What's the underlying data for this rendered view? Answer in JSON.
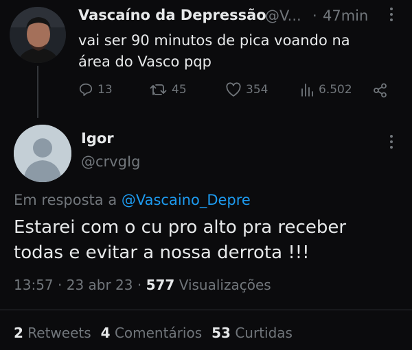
{
  "original_tweet": {
    "display_name": "Vascaíno da Depressão",
    "handle": "@V...",
    "separator": "·",
    "time": "47min",
    "text_line1": "vai ser 90 minutos de pica voando na",
    "text_line2": "área do Vasco pqp",
    "actions": {
      "replies": "13",
      "retweets": "45",
      "likes": "354",
      "views": "6.502"
    }
  },
  "reply_tweet": {
    "display_name": "Igor",
    "handle": "@crvgIg",
    "reply_prefix": "Em resposta a",
    "reply_mention": "@Vascaino_Depre",
    "text_line1": "Estarei com o cu pro alto pra receber",
    "text_line2": "todas e evitar a nossa derrota !!!",
    "time": "13:57",
    "date": "23 abr 23",
    "dot": "·",
    "views_count": "577",
    "views_label": "Visualizações"
  },
  "stats": {
    "retweets_count": "2",
    "retweets_label": "Retweets",
    "comments_count": "4",
    "comments_label": "Comentários",
    "likes_count": "53",
    "likes_label": "Curtidas"
  },
  "colors": {
    "background": "#0b0b0d",
    "text": "#e7e9ea",
    "muted": "#71767b",
    "link": "#1d9bf0"
  }
}
